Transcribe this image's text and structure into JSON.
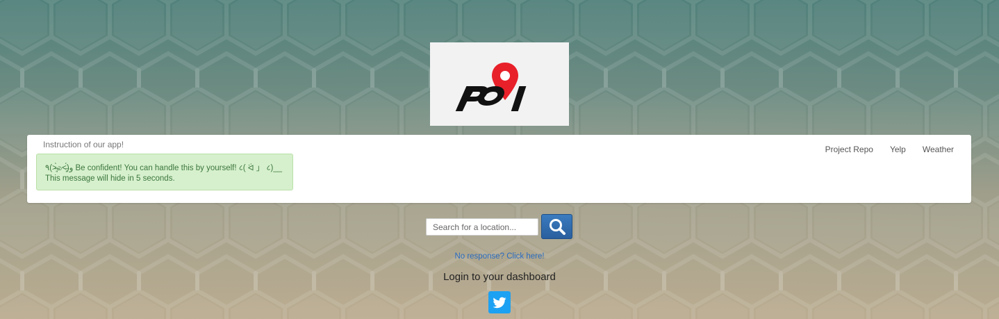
{
  "logo": {
    "text": "POI",
    "brand_color": "#e8202a"
  },
  "panel": {
    "title": "Instruction of our app!",
    "nav": [
      {
        "label": "Project Repo"
      },
      {
        "label": "Yelp"
      },
      {
        "label": "Weather"
      }
    ],
    "alert": {
      "line1": "٩(˃̶͈̀௰˂̶͈́)و Be confident! You can handle this by yourself! ८( ᐛ 」 ८)__",
      "line2": "This message will hide in 5 seconds."
    }
  },
  "search": {
    "placeholder": "Search for a location...",
    "value": "",
    "button_icon": "search-icon"
  },
  "links": {
    "no_response": "No response? Click here!"
  },
  "login": {
    "title": "Login to your dashboard",
    "twitter_icon": "twitter-icon"
  },
  "colors": {
    "accent_blue": "#2a6cc0",
    "alert_bg": "#d6f0cd",
    "alert_text": "#3c763d",
    "twitter": "#1da1f2",
    "search_button": "#2f6dad"
  }
}
